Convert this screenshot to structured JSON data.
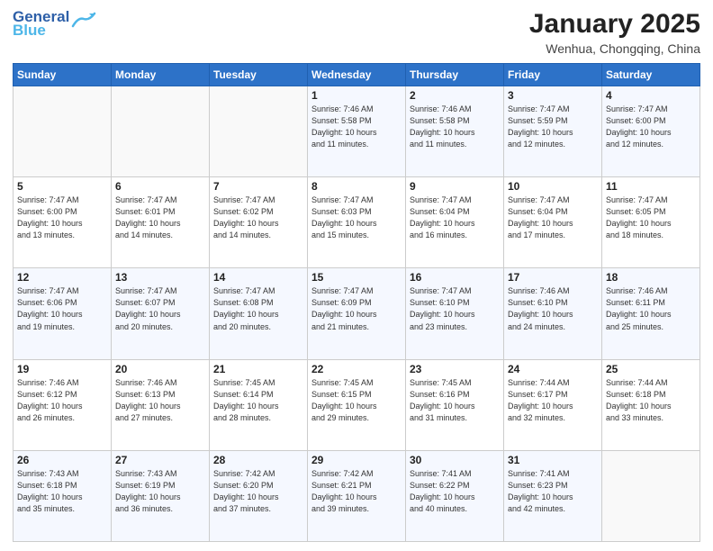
{
  "header": {
    "logo_line1": "General",
    "logo_line2": "Blue",
    "month_title": "January 2025",
    "location": "Wenhua, Chongqing, China"
  },
  "days_of_week": [
    "Sunday",
    "Monday",
    "Tuesday",
    "Wednesday",
    "Thursday",
    "Friday",
    "Saturday"
  ],
  "weeks": [
    [
      {
        "day": "",
        "info": ""
      },
      {
        "day": "",
        "info": ""
      },
      {
        "day": "",
        "info": ""
      },
      {
        "day": "1",
        "info": "Sunrise: 7:46 AM\nSunset: 5:58 PM\nDaylight: 10 hours\nand 11 minutes."
      },
      {
        "day": "2",
        "info": "Sunrise: 7:46 AM\nSunset: 5:58 PM\nDaylight: 10 hours\nand 11 minutes."
      },
      {
        "day": "3",
        "info": "Sunrise: 7:47 AM\nSunset: 5:59 PM\nDaylight: 10 hours\nand 12 minutes."
      },
      {
        "day": "4",
        "info": "Sunrise: 7:47 AM\nSunset: 6:00 PM\nDaylight: 10 hours\nand 12 minutes."
      }
    ],
    [
      {
        "day": "5",
        "info": "Sunrise: 7:47 AM\nSunset: 6:00 PM\nDaylight: 10 hours\nand 13 minutes."
      },
      {
        "day": "6",
        "info": "Sunrise: 7:47 AM\nSunset: 6:01 PM\nDaylight: 10 hours\nand 14 minutes."
      },
      {
        "day": "7",
        "info": "Sunrise: 7:47 AM\nSunset: 6:02 PM\nDaylight: 10 hours\nand 14 minutes."
      },
      {
        "day": "8",
        "info": "Sunrise: 7:47 AM\nSunset: 6:03 PM\nDaylight: 10 hours\nand 15 minutes."
      },
      {
        "day": "9",
        "info": "Sunrise: 7:47 AM\nSunset: 6:04 PM\nDaylight: 10 hours\nand 16 minutes."
      },
      {
        "day": "10",
        "info": "Sunrise: 7:47 AM\nSunset: 6:04 PM\nDaylight: 10 hours\nand 17 minutes."
      },
      {
        "day": "11",
        "info": "Sunrise: 7:47 AM\nSunset: 6:05 PM\nDaylight: 10 hours\nand 18 minutes."
      }
    ],
    [
      {
        "day": "12",
        "info": "Sunrise: 7:47 AM\nSunset: 6:06 PM\nDaylight: 10 hours\nand 19 minutes."
      },
      {
        "day": "13",
        "info": "Sunrise: 7:47 AM\nSunset: 6:07 PM\nDaylight: 10 hours\nand 20 minutes."
      },
      {
        "day": "14",
        "info": "Sunrise: 7:47 AM\nSunset: 6:08 PM\nDaylight: 10 hours\nand 20 minutes."
      },
      {
        "day": "15",
        "info": "Sunrise: 7:47 AM\nSunset: 6:09 PM\nDaylight: 10 hours\nand 21 minutes."
      },
      {
        "day": "16",
        "info": "Sunrise: 7:47 AM\nSunset: 6:10 PM\nDaylight: 10 hours\nand 23 minutes."
      },
      {
        "day": "17",
        "info": "Sunrise: 7:46 AM\nSunset: 6:10 PM\nDaylight: 10 hours\nand 24 minutes."
      },
      {
        "day": "18",
        "info": "Sunrise: 7:46 AM\nSunset: 6:11 PM\nDaylight: 10 hours\nand 25 minutes."
      }
    ],
    [
      {
        "day": "19",
        "info": "Sunrise: 7:46 AM\nSunset: 6:12 PM\nDaylight: 10 hours\nand 26 minutes."
      },
      {
        "day": "20",
        "info": "Sunrise: 7:46 AM\nSunset: 6:13 PM\nDaylight: 10 hours\nand 27 minutes."
      },
      {
        "day": "21",
        "info": "Sunrise: 7:45 AM\nSunset: 6:14 PM\nDaylight: 10 hours\nand 28 minutes."
      },
      {
        "day": "22",
        "info": "Sunrise: 7:45 AM\nSunset: 6:15 PM\nDaylight: 10 hours\nand 29 minutes."
      },
      {
        "day": "23",
        "info": "Sunrise: 7:45 AM\nSunset: 6:16 PM\nDaylight: 10 hours\nand 31 minutes."
      },
      {
        "day": "24",
        "info": "Sunrise: 7:44 AM\nSunset: 6:17 PM\nDaylight: 10 hours\nand 32 minutes."
      },
      {
        "day": "25",
        "info": "Sunrise: 7:44 AM\nSunset: 6:18 PM\nDaylight: 10 hours\nand 33 minutes."
      }
    ],
    [
      {
        "day": "26",
        "info": "Sunrise: 7:43 AM\nSunset: 6:18 PM\nDaylight: 10 hours\nand 35 minutes."
      },
      {
        "day": "27",
        "info": "Sunrise: 7:43 AM\nSunset: 6:19 PM\nDaylight: 10 hours\nand 36 minutes."
      },
      {
        "day": "28",
        "info": "Sunrise: 7:42 AM\nSunset: 6:20 PM\nDaylight: 10 hours\nand 37 minutes."
      },
      {
        "day": "29",
        "info": "Sunrise: 7:42 AM\nSunset: 6:21 PM\nDaylight: 10 hours\nand 39 minutes."
      },
      {
        "day": "30",
        "info": "Sunrise: 7:41 AM\nSunset: 6:22 PM\nDaylight: 10 hours\nand 40 minutes."
      },
      {
        "day": "31",
        "info": "Sunrise: 7:41 AM\nSunset: 6:23 PM\nDaylight: 10 hours\nand 42 minutes."
      },
      {
        "day": "",
        "info": ""
      }
    ]
  ]
}
